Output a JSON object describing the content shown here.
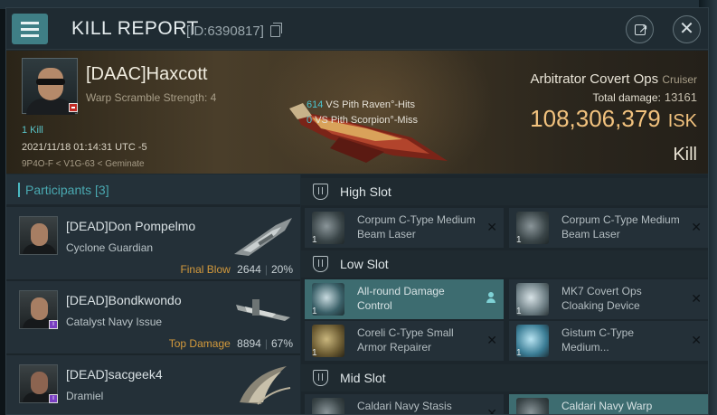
{
  "header": {
    "title": "KILL REPORT",
    "id_label": "[ID:6390817]"
  },
  "victim": {
    "name": "[DAAC]Haxcott",
    "warp_scramble": "Warp Scramble Strength: 4",
    "kills": "1 Kill",
    "date": "2021/11/18 01:14:31 UTC -5",
    "location": "9P4O-F < V1G-63 < Geminate",
    "ship_name": "Arbitrator Covert Ops",
    "ship_class": "Cruiser",
    "total_damage_label": "Total damage:",
    "total_damage": "13161",
    "isk_value": "108,306,379",
    "isk_unit": "ISK",
    "result": "Kill",
    "hits_count": "614",
    "hits_text": "VS Pith Raven°-Hits",
    "miss_count": "0",
    "miss_text": "VS Pith Scorpion°-Miss"
  },
  "participants": {
    "title": "Participants",
    "count": "[3]",
    "items": [
      {
        "name": "[DEAD]Don Pompelmo",
        "ship": "Cyclone Guardian",
        "tag": "Final Blow",
        "damage": "2644",
        "percent": "20%"
      },
      {
        "name": "[DEAD]Bondkwondo",
        "ship": "Catalyst Navy Issue",
        "tag": "Top Damage",
        "damage": "8894",
        "percent": "67%"
      },
      {
        "name": "[DEAD]sacgeek4",
        "ship": "Dramiel",
        "tag": "",
        "damage": "",
        "percent": ""
      }
    ]
  },
  "slots": {
    "high": {
      "label": "High Slot",
      "modules": [
        {
          "qty": "1",
          "name": "Corpum C-Type Medium Beam Laser"
        },
        {
          "qty": "1",
          "name": "Corpum C-Type Medium Beam Laser"
        }
      ]
    },
    "low": {
      "label": "Low Slot",
      "modules": [
        {
          "qty": "1",
          "name": "All-round Damage Control"
        },
        {
          "qty": "1",
          "name": "MK7 Covert Ops Cloaking Device"
        },
        {
          "qty": "1",
          "name": "Coreli C-Type Small Armor Repairer"
        },
        {
          "qty": "1",
          "name": "Gistum C-Type Medium..."
        }
      ]
    },
    "mid": {
      "label": "Mid Slot",
      "modules": [
        {
          "qty": "1",
          "name": "Caldari Navy Stasis"
        },
        {
          "qty": "1",
          "name": "Caldari Navy Warp"
        }
      ]
    }
  },
  "icons": {
    "menu": "hamburger-menu-icon",
    "copy": "copy-icon",
    "share": "share-icon",
    "close": "close-icon",
    "slot": "slot-shield-icon",
    "remove": "close-icon",
    "person": "person-icon"
  },
  "colors": {
    "accent_teal": "#3f7f86",
    "isk_gold": "#f2c27e",
    "final_blow_orange": "#d49a3c",
    "highlight_row": "#3d6c70"
  }
}
